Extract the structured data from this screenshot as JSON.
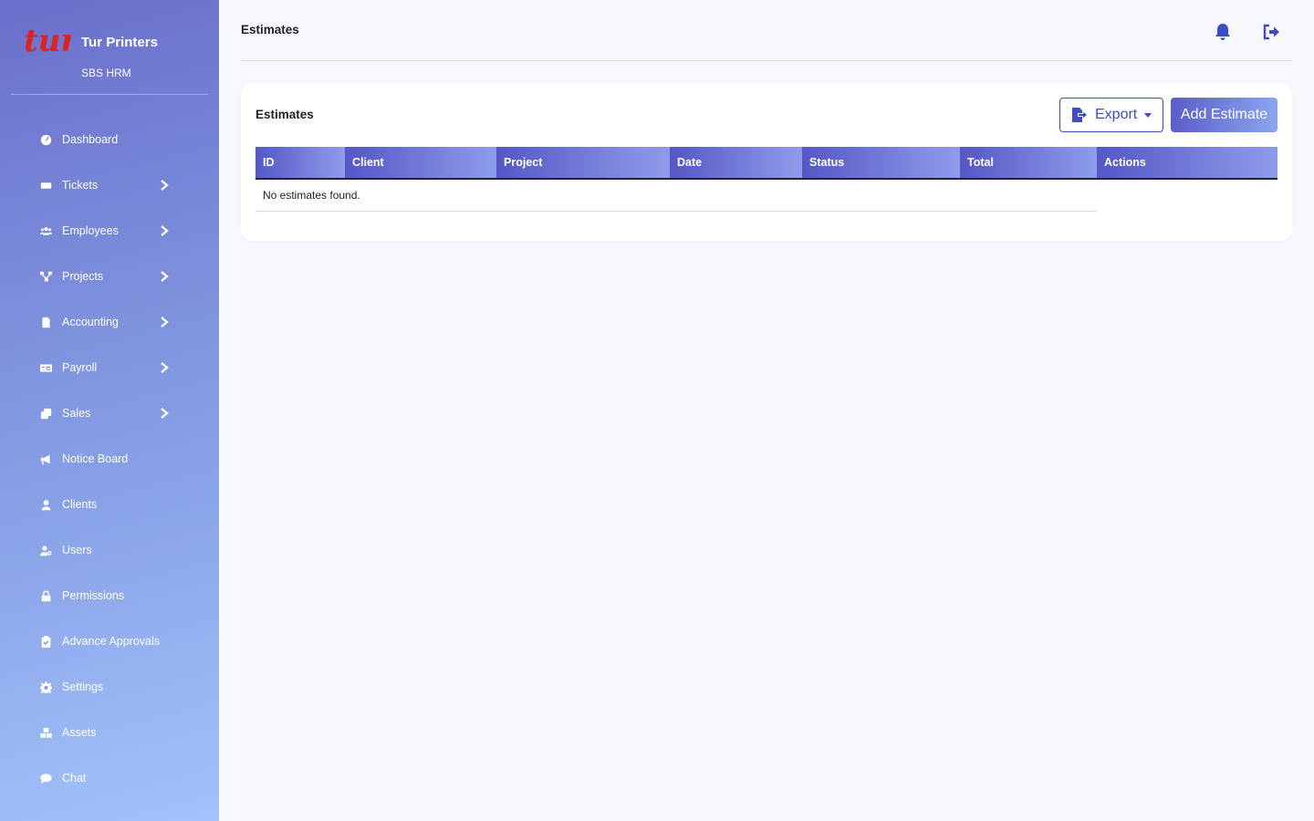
{
  "brand": {
    "logo_text": "tur",
    "name": "Tur Printers",
    "subtitle": "SBS HRM"
  },
  "sidebar": {
    "items": [
      {
        "label": "Dashboard",
        "icon": "gauge-icon",
        "has_submenu": false
      },
      {
        "label": "Tickets",
        "icon": "ticket-icon",
        "has_submenu": true
      },
      {
        "label": "Employees",
        "icon": "users-icon",
        "has_submenu": true
      },
      {
        "label": "Projects",
        "icon": "sitemap-icon",
        "has_submenu": true
      },
      {
        "label": "Accounting",
        "icon": "file-invoice-icon",
        "has_submenu": true
      },
      {
        "label": "Payroll",
        "icon": "money-check-icon",
        "has_submenu": true
      },
      {
        "label": "Sales",
        "icon": "clone-icon",
        "has_submenu": true
      },
      {
        "label": "Notice Board",
        "icon": "megaphone-icon",
        "has_submenu": false
      },
      {
        "label": "Clients",
        "icon": "user-icon",
        "has_submenu": false
      },
      {
        "label": "Users",
        "icon": "user-gear-icon",
        "has_submenu": false
      },
      {
        "label": "Permissions",
        "icon": "lock-icon",
        "has_submenu": false
      },
      {
        "label": "Advance Approvals",
        "icon": "clipboard-check-icon",
        "has_submenu": false
      },
      {
        "label": "Settings",
        "icon": "gear-icon",
        "has_submenu": false
      },
      {
        "label": "Assets",
        "icon": "cubes-icon",
        "has_submenu": false
      },
      {
        "label": "Chat",
        "icon": "comment-icon",
        "has_submenu": false
      }
    ]
  },
  "header": {
    "title": "Estimates",
    "icons": [
      "bell-icon",
      "logout-icon"
    ]
  },
  "card": {
    "title": "Estimates",
    "export_label": "Export",
    "add_label": "Add Estimate"
  },
  "table": {
    "columns": [
      "ID",
      "Client",
      "Project",
      "Date",
      "Status",
      "Total",
      "Actions"
    ],
    "empty_message": "No estimates found."
  },
  "colors": {
    "accent": "#3d4bc4",
    "sidebar_top": "#6a6fcb",
    "sidebar_bottom": "#a2c2fb",
    "logo_red": "#e0211f"
  }
}
